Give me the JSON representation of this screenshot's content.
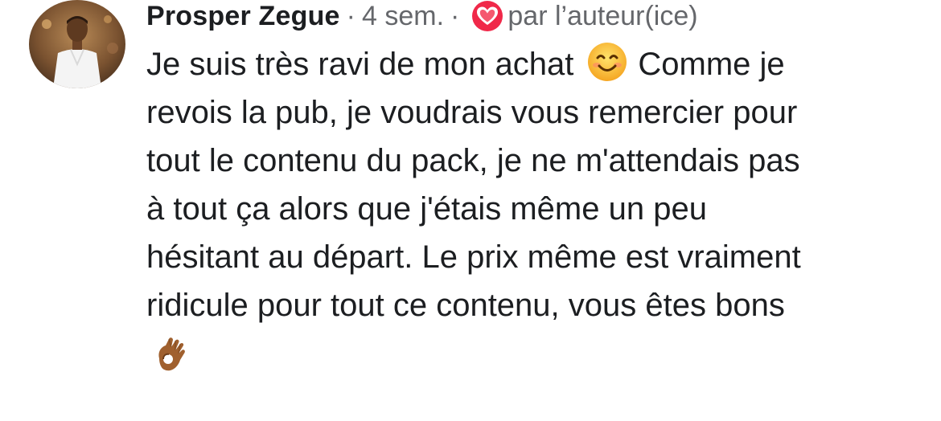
{
  "comment": {
    "author": "Prosper Zegue",
    "separator": "·",
    "time": "4 sem.",
    "reaction_icon": "heart-icon",
    "liked_by": "par l’auteur(ice)",
    "body_lines": [
      "Je suis très ravi de mon achat",
      "Comme je",
      "revois la pub, je voudrais vous remercier pour",
      "tout le contenu du pack, je ne m'attendais pas",
      "à tout ça alors que j'étais même un peu",
      "hésitant au départ. Le prix même est vraiment",
      "ridicule pour tout ce contenu, vous êtes bons"
    ],
    "emoji_inline": "smiling-face-emoji",
    "emoji_end": "ok-hand-emoji",
    "colors": {
      "author": "#1c1e21",
      "meta": "#65676b",
      "heart_outer": "#f02849",
      "heart_inner": "#ffffff"
    }
  }
}
